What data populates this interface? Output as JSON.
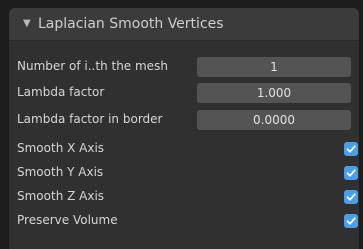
{
  "panel": {
    "title": "Laplacian Smooth Vertices",
    "expanded_icon": "disclosure-triangle-down-icon"
  },
  "fields": [
    {
      "label": "Number of i..th the mesh",
      "value": "1"
    },
    {
      "label": "Lambda factor",
      "value": "1.000"
    },
    {
      "label": "Lambda factor in border",
      "value": "0.0000"
    }
  ],
  "toggles": [
    {
      "label": "Smooth X Axis",
      "checked": true
    },
    {
      "label": "Smooth Y Axis",
      "checked": true
    },
    {
      "label": "Smooth Z Axis",
      "checked": true
    },
    {
      "label": "Preserve Volume",
      "checked": true
    }
  ],
  "colors": {
    "accent": "#4b9fe8",
    "field_bg": "#545454",
    "panel_bg": "#303030",
    "header_bg": "#3b3b3b"
  }
}
